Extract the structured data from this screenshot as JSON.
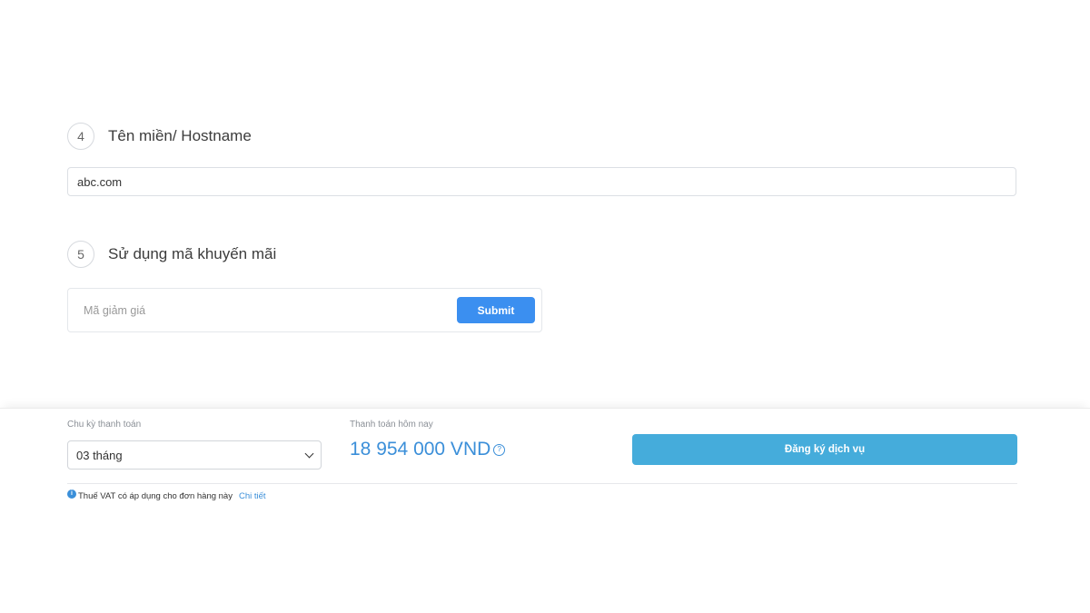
{
  "steps": [
    {
      "number": "4",
      "title": "Tên miền/ Hostname"
    },
    {
      "number": "5",
      "title": "Sử dụng mã khuyến mãi"
    }
  ],
  "hostname": {
    "value": "abc.com"
  },
  "promo": {
    "placeholder": "Mã giảm giá",
    "submit_label": "Submit"
  },
  "billing": {
    "cycle_label": "Chu kỳ thanh toán",
    "cycle_selected": "03 tháng",
    "pay_label": "Thanh toán hôm nay",
    "price": "18 954 000 VND",
    "register_label": "Đăng ký dịch vụ",
    "vat_note": "Thuế VAT có áp dụng cho đơn hàng này",
    "vat_link": "Chi tiết"
  },
  "colors": {
    "primary_button": "#3b8ff0",
    "register_button": "#45acdb",
    "price_text": "#3b8fd9"
  }
}
